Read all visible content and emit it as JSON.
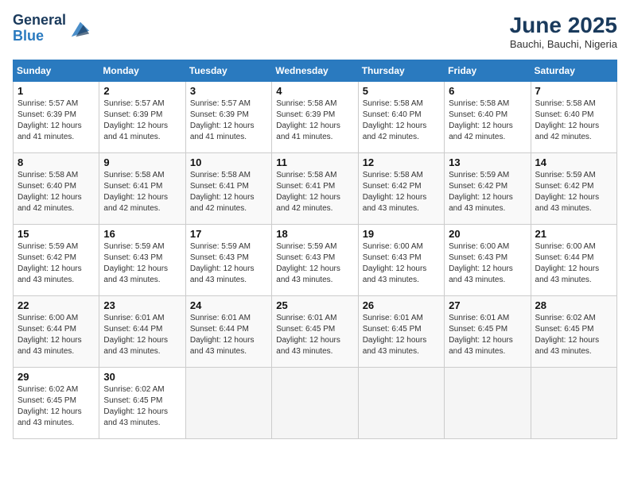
{
  "header": {
    "logo_line1": "General",
    "logo_line2": "Blue",
    "month_title": "June 2025",
    "subtitle": "Bauchi, Bauchi, Nigeria"
  },
  "days_of_week": [
    "Sunday",
    "Monday",
    "Tuesday",
    "Wednesday",
    "Thursday",
    "Friday",
    "Saturday"
  ],
  "weeks": [
    [
      {
        "day": 1,
        "sunrise": "5:57 AM",
        "sunset": "6:39 PM",
        "daylight": "12 hours and 41 minutes."
      },
      {
        "day": 2,
        "sunrise": "5:57 AM",
        "sunset": "6:39 PM",
        "daylight": "12 hours and 41 minutes."
      },
      {
        "day": 3,
        "sunrise": "5:57 AM",
        "sunset": "6:39 PM",
        "daylight": "12 hours and 41 minutes."
      },
      {
        "day": 4,
        "sunrise": "5:58 AM",
        "sunset": "6:39 PM",
        "daylight": "12 hours and 41 minutes."
      },
      {
        "day": 5,
        "sunrise": "5:58 AM",
        "sunset": "6:40 PM",
        "daylight": "12 hours and 42 minutes."
      },
      {
        "day": 6,
        "sunrise": "5:58 AM",
        "sunset": "6:40 PM",
        "daylight": "12 hours and 42 minutes."
      },
      {
        "day": 7,
        "sunrise": "5:58 AM",
        "sunset": "6:40 PM",
        "daylight": "12 hours and 42 minutes."
      }
    ],
    [
      {
        "day": 8,
        "sunrise": "5:58 AM",
        "sunset": "6:40 PM",
        "daylight": "12 hours and 42 minutes."
      },
      {
        "day": 9,
        "sunrise": "5:58 AM",
        "sunset": "6:41 PM",
        "daylight": "12 hours and 42 minutes."
      },
      {
        "day": 10,
        "sunrise": "5:58 AM",
        "sunset": "6:41 PM",
        "daylight": "12 hours and 42 minutes."
      },
      {
        "day": 11,
        "sunrise": "5:58 AM",
        "sunset": "6:41 PM",
        "daylight": "12 hours and 42 minutes."
      },
      {
        "day": 12,
        "sunrise": "5:58 AM",
        "sunset": "6:42 PM",
        "daylight": "12 hours and 43 minutes."
      },
      {
        "day": 13,
        "sunrise": "5:59 AM",
        "sunset": "6:42 PM",
        "daylight": "12 hours and 43 minutes."
      },
      {
        "day": 14,
        "sunrise": "5:59 AM",
        "sunset": "6:42 PM",
        "daylight": "12 hours and 43 minutes."
      }
    ],
    [
      {
        "day": 15,
        "sunrise": "5:59 AM",
        "sunset": "6:42 PM",
        "daylight": "12 hours and 43 minutes."
      },
      {
        "day": 16,
        "sunrise": "5:59 AM",
        "sunset": "6:43 PM",
        "daylight": "12 hours and 43 minutes."
      },
      {
        "day": 17,
        "sunrise": "5:59 AM",
        "sunset": "6:43 PM",
        "daylight": "12 hours and 43 minutes."
      },
      {
        "day": 18,
        "sunrise": "5:59 AM",
        "sunset": "6:43 PM",
        "daylight": "12 hours and 43 minutes."
      },
      {
        "day": 19,
        "sunrise": "6:00 AM",
        "sunset": "6:43 PM",
        "daylight": "12 hours and 43 minutes."
      },
      {
        "day": 20,
        "sunrise": "6:00 AM",
        "sunset": "6:43 PM",
        "daylight": "12 hours and 43 minutes."
      },
      {
        "day": 21,
        "sunrise": "6:00 AM",
        "sunset": "6:44 PM",
        "daylight": "12 hours and 43 minutes."
      }
    ],
    [
      {
        "day": 22,
        "sunrise": "6:00 AM",
        "sunset": "6:44 PM",
        "daylight": "12 hours and 43 minutes."
      },
      {
        "day": 23,
        "sunrise": "6:01 AM",
        "sunset": "6:44 PM",
        "daylight": "12 hours and 43 minutes."
      },
      {
        "day": 24,
        "sunrise": "6:01 AM",
        "sunset": "6:44 PM",
        "daylight": "12 hours and 43 minutes."
      },
      {
        "day": 25,
        "sunrise": "6:01 AM",
        "sunset": "6:45 PM",
        "daylight": "12 hours and 43 minutes."
      },
      {
        "day": 26,
        "sunrise": "6:01 AM",
        "sunset": "6:45 PM",
        "daylight": "12 hours and 43 minutes."
      },
      {
        "day": 27,
        "sunrise": "6:01 AM",
        "sunset": "6:45 PM",
        "daylight": "12 hours and 43 minutes."
      },
      {
        "day": 28,
        "sunrise": "6:02 AM",
        "sunset": "6:45 PM",
        "daylight": "12 hours and 43 minutes."
      }
    ],
    [
      {
        "day": 29,
        "sunrise": "6:02 AM",
        "sunset": "6:45 PM",
        "daylight": "12 hours and 43 minutes."
      },
      {
        "day": 30,
        "sunrise": "6:02 AM",
        "sunset": "6:45 PM",
        "daylight": "12 hours and 43 minutes."
      },
      null,
      null,
      null,
      null,
      null
    ]
  ],
  "labels": {
    "sunrise": "Sunrise:",
    "sunset": "Sunset:",
    "daylight": "Daylight:"
  }
}
